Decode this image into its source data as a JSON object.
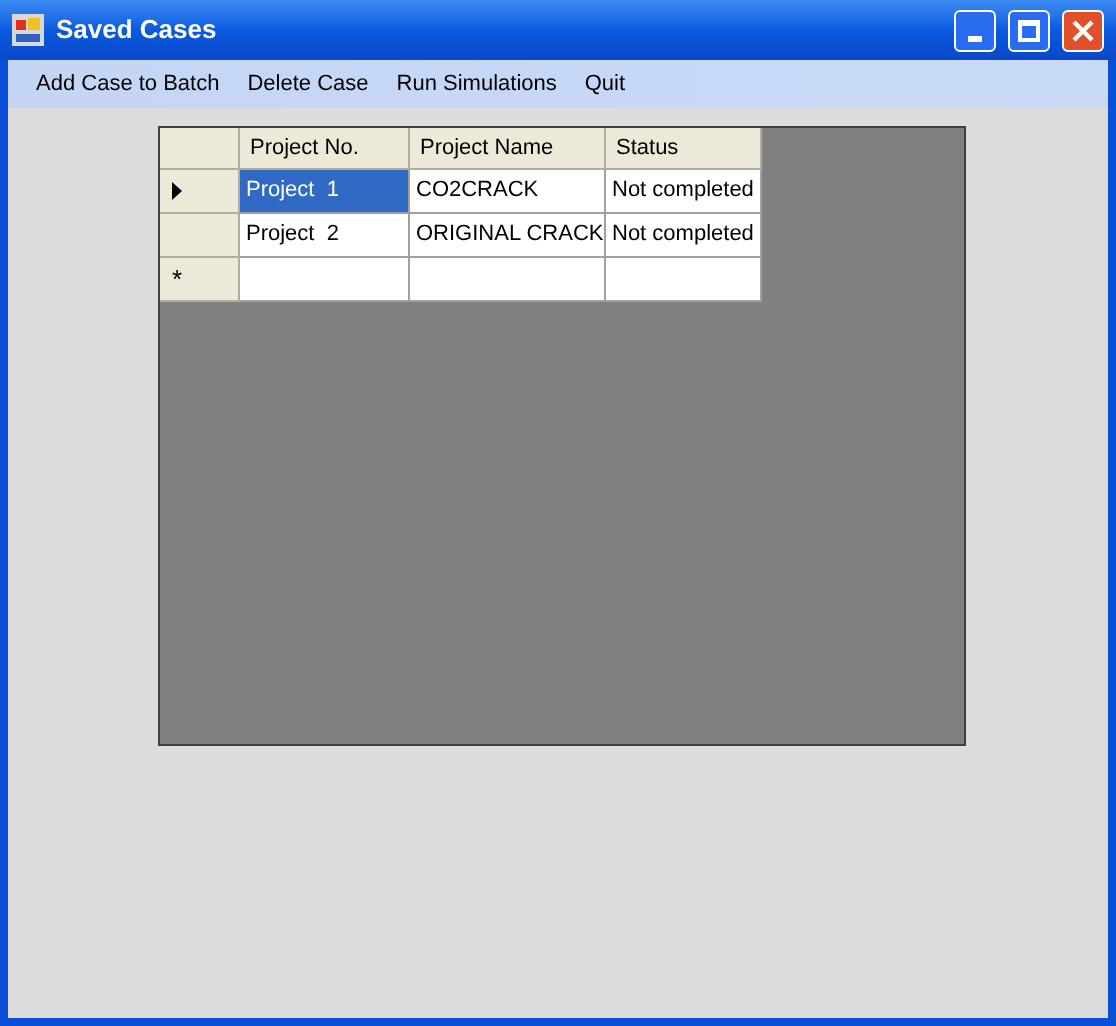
{
  "window": {
    "title": "Saved Cases"
  },
  "menu": [
    {
      "label": "Add Case to Batch"
    },
    {
      "label": "Delete Case"
    },
    {
      "label": "Run Simulations"
    },
    {
      "label": "Quit"
    }
  ],
  "table": {
    "columns": [
      "Project No.",
      "Project Name",
      "Status"
    ],
    "rows": [
      {
        "kind": "data",
        "current": true,
        "cells": [
          {
            "text": "Project  1",
            "selected": true
          },
          {
            "text": "CO2CRACK",
            "selected": false
          },
          {
            "text": "Not completed",
            "selected": false
          }
        ]
      },
      {
        "kind": "data",
        "current": false,
        "cells": [
          {
            "text": "Project  2",
            "selected": false
          },
          {
            "text": "ORIGINAL CRACK",
            "selected": false
          },
          {
            "text": "Not completed",
            "selected": false
          }
        ]
      },
      {
        "kind": "new",
        "marker": "*"
      }
    ]
  }
}
